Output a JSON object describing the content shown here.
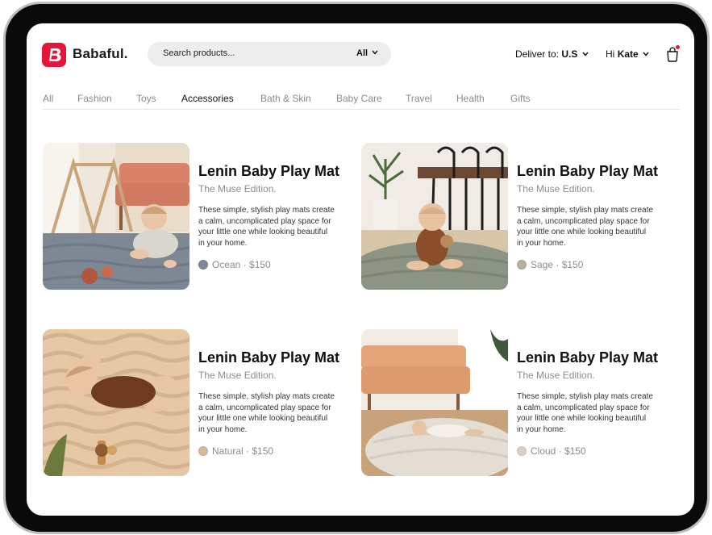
{
  "brand": {
    "name": "Babaful.",
    "accent": "#e5163a"
  },
  "search": {
    "placeholder": "Search products...",
    "filter_label": "All"
  },
  "header": {
    "deliver_prefix": "Deliver to:",
    "deliver_region": "U.S",
    "greeting_prefix": "Hi",
    "user_name": "Kate",
    "cart_icon": "shopping-bag-icon"
  },
  "tabs": [
    {
      "label": "All",
      "active": false
    },
    {
      "label": "Fashion",
      "active": false
    },
    {
      "label": "Toys",
      "active": false
    },
    {
      "label": "Accessories",
      "active": true
    },
    {
      "label": "Bath & Skin",
      "active": false
    },
    {
      "label": "Baby Care",
      "active": false
    },
    {
      "label": "Travel",
      "active": false
    },
    {
      "label": "Health",
      "active": false
    },
    {
      "label": "Gifts",
      "active": false
    }
  ],
  "products": [
    {
      "title": "Lenin Baby Play Mat",
      "subtitle": "The Muse Edition.",
      "description": "These simple, stylish play mats create a calm, uncomplicated play space for your little one while looking beautiful in your home.",
      "variant": "Ocean · $150",
      "swatch_color": "#7e8898"
    },
    {
      "title": "Lenin Baby Play Mat",
      "subtitle": "The Muse Edition.",
      "description": "These simple, stylish play mats create a calm, uncomplicated play space for your little one while looking beautiful in your home.",
      "variant": "Sage · $150",
      "swatch_color": "#b8b19c"
    },
    {
      "title": "Lenin Baby Play Mat",
      "subtitle": "The Muse Edition.",
      "description": "These simple, stylish play mats create a calm, uncomplicated play space for your little one while looking beautiful in your home.",
      "variant": "Natural · $150",
      "swatch_color": "#d8b89a"
    },
    {
      "title": "Lenin Baby Play Mat",
      "subtitle": "The Muse Edition.",
      "description": "These simple, stylish play mats create a calm, uncomplicated play space for your little one while looking beautiful in your home.",
      "variant": "Cloud · $150",
      "swatch_color": "#d9cfc6"
    }
  ]
}
